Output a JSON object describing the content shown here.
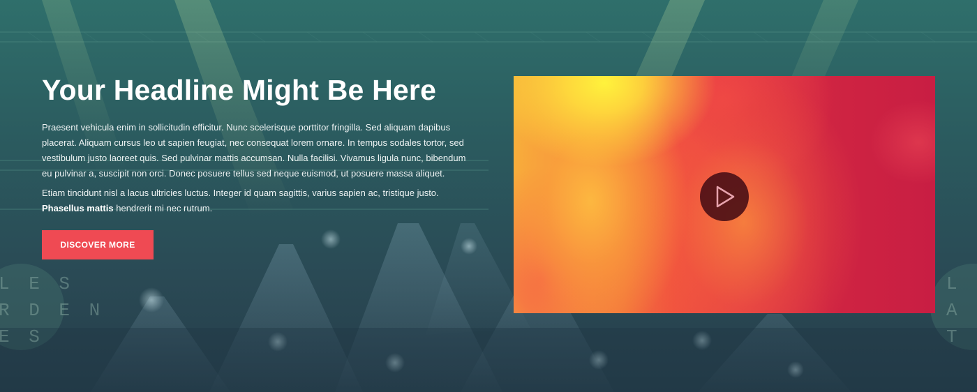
{
  "hero": {
    "headline": "Your Headline Might Be Here",
    "paragraph": "Praesent vehicula enim in sollicitudin efficitur. Nunc scelerisque porttitor fringilla. Sed aliquam dapibus placerat. Aliquam cursus leo ut sapien feugiat, nec consequat lorem ornare. In tempus sodales tortor, sed vestibulum justo laoreet quis. Sed pulvinar mattis accumsan. Nulla facilisi. Vivamus ligula nunc, bibendum eu pulvinar a, suscipit non orci. Donec posuere tellus sed neque euismod, ut posuere massa aliquet.",
    "paragraph2_text": "Etiam tincidunt nisl a lacus ultricies luctus. Integer id quam sagittis, varius sapien ac, tristique justo.",
    "paragraph2_bold": "Phasellus mattis",
    "paragraph2_tail": "hendrerit mi nec rutrum.",
    "cta_label": "DISCOVER MORE",
    "cta_color": "#ef4a53"
  },
  "video": {
    "play_icon": "play-icon"
  },
  "background": {
    "signage_left": [
      "L E S",
      "R D E N",
      "E S"
    ],
    "signage_right": [
      "L E",
      "A R D E",
      "T E"
    ],
    "colors": {
      "top": "#2f6f6b",
      "bottom": "#263d4a"
    }
  }
}
